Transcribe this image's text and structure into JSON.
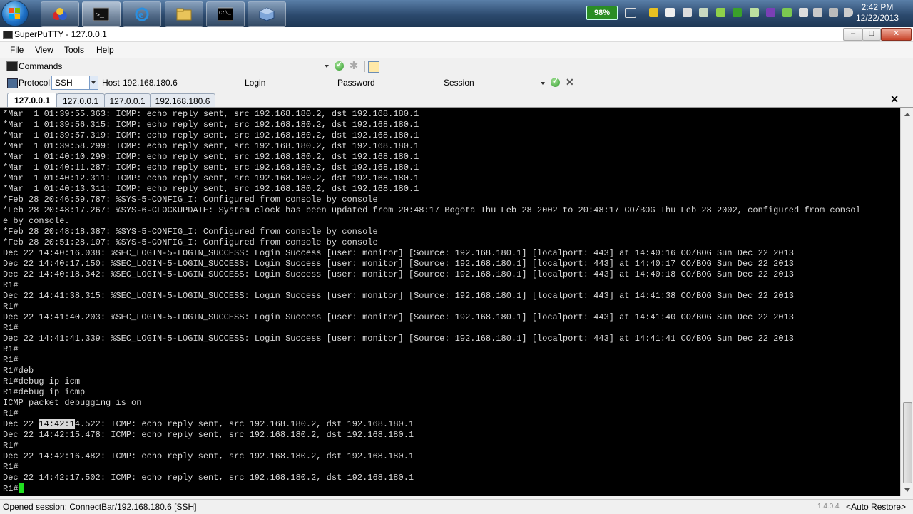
{
  "taskbar": {
    "apps": [
      "start-menu",
      "color-app",
      "command-prompt",
      "internet-explorer",
      "file-explorer",
      "console-app",
      "virtualbox"
    ],
    "battery": "98%",
    "clock_time": "2:42 PM",
    "clock_date": "12/22/2013"
  },
  "window": {
    "title": "SuperPuTTY - 127.0.0.1",
    "min": "–",
    "max": "□",
    "close": "✕"
  },
  "menu": {
    "file": "File",
    "view": "View",
    "tools": "Tools",
    "help": "Help"
  },
  "commands": {
    "label": "Commands"
  },
  "connection": {
    "protocol_label": "Protocol",
    "protocol_value": "SSH",
    "host_label": "Host",
    "host_value": "192.168.180.6",
    "login_label": "Login",
    "password_label": "Password",
    "session_label": "Session"
  },
  "tabs": [
    {
      "label": "127.0.0.1",
      "active": true
    },
    {
      "label": "127.0.0.1",
      "active": false
    },
    {
      "label": "127.0.0.1",
      "active": false
    },
    {
      "label": "192.168.180.6",
      "active": false
    }
  ],
  "tab_close": "✕",
  "terminal": {
    "lines": [
      "*Mar  1 01:39:55.363: ICMP: echo reply sent, src 192.168.180.2, dst 192.168.180.1",
      "*Mar  1 01:39:56.315: ICMP: echo reply sent, src 192.168.180.2, dst 192.168.180.1",
      "*Mar  1 01:39:57.319: ICMP: echo reply sent, src 192.168.180.2, dst 192.168.180.1",
      "*Mar  1 01:39:58.299: ICMP: echo reply sent, src 192.168.180.2, dst 192.168.180.1",
      "*Mar  1 01:40:10.299: ICMP: echo reply sent, src 192.168.180.2, dst 192.168.180.1",
      "*Mar  1 01:40:11.287: ICMP: echo reply sent, src 192.168.180.2, dst 192.168.180.1",
      "*Mar  1 01:40:12.311: ICMP: echo reply sent, src 192.168.180.2, dst 192.168.180.1",
      "*Mar  1 01:40:13.311: ICMP: echo reply sent, src 192.168.180.2, dst 192.168.180.1",
      "*Feb 28 20:46:59.787: %SYS-5-CONFIG_I: Configured from console by console",
      "*Feb 28 20:48:17.267: %SYS-6-CLOCKUPDATE: System clock has been updated from 20:48:17 Bogota Thu Feb 28 2002 to 20:48:17 CO/BOG Thu Feb 28 2002, configured from consol",
      "e by console.",
      "*Feb 28 20:48:18.387: %SYS-5-CONFIG_I: Configured from console by console",
      "*Feb 28 20:51:28.107: %SYS-5-CONFIG_I: Configured from console by console",
      "Dec 22 14:40:16.038: %SEC_LOGIN-5-LOGIN_SUCCESS: Login Success [user: monitor] [Source: 192.168.180.1] [localport: 443] at 14:40:16 CO/BOG Sun Dec 22 2013",
      "Dec 22 14:40:17.150: %SEC_LOGIN-5-LOGIN_SUCCESS: Login Success [user: monitor] [Source: 192.168.180.1] [localport: 443] at 14:40:17 CO/BOG Sun Dec 22 2013",
      "Dec 22 14:40:18.342: %SEC_LOGIN-5-LOGIN_SUCCESS: Login Success [user: monitor] [Source: 192.168.180.1] [localport: 443] at 14:40:18 CO/BOG Sun Dec 22 2013",
      "R1#",
      "Dec 22 14:41:38.315: %SEC_LOGIN-5-LOGIN_SUCCESS: Login Success [user: monitor] [Source: 192.168.180.1] [localport: 443] at 14:41:38 CO/BOG Sun Dec 22 2013",
      "R1#",
      "Dec 22 14:41:40.203: %SEC_LOGIN-5-LOGIN_SUCCESS: Login Success [user: monitor] [Source: 192.168.180.1] [localport: 443] at 14:41:40 CO/BOG Sun Dec 22 2013",
      "R1#",
      "Dec 22 14:41:41.339: %SEC_LOGIN-5-LOGIN_SUCCESS: Login Success [user: monitor] [Source: 192.168.180.1] [localport: 443] at 14:41:41 CO/BOG Sun Dec 22 2013",
      "R1#",
      "R1#",
      "R1#deb",
      "R1#debug ip icm",
      "R1#debug ip icmp",
      "ICMP packet debugging is on",
      "R1#"
    ],
    "selected_line": {
      "prefix": "Dec 22 ",
      "selection": "14:42:1",
      "suffix": "4.522: ICMP: echo reply sent, src 192.168.180.2, dst 192.168.180.1"
    },
    "lines_after": [
      "Dec 22 14:42:15.478: ICMP: echo reply sent, src 192.168.180.2, dst 192.168.180.1",
      "R1#",
      "Dec 22 14:42:16.482: ICMP: echo reply sent, src 192.168.180.2, dst 192.168.180.1",
      "R1#",
      "Dec 22 14:42:17.502: ICMP: echo reply sent, src 192.168.180.2, dst 192.168.180.1",
      "R1#"
    ]
  },
  "status": {
    "text": "Opened session: ConnectBar/192.168.180.6 [SSH]",
    "version": "1.4.0.4",
    "restore": "<Auto Restore>"
  }
}
